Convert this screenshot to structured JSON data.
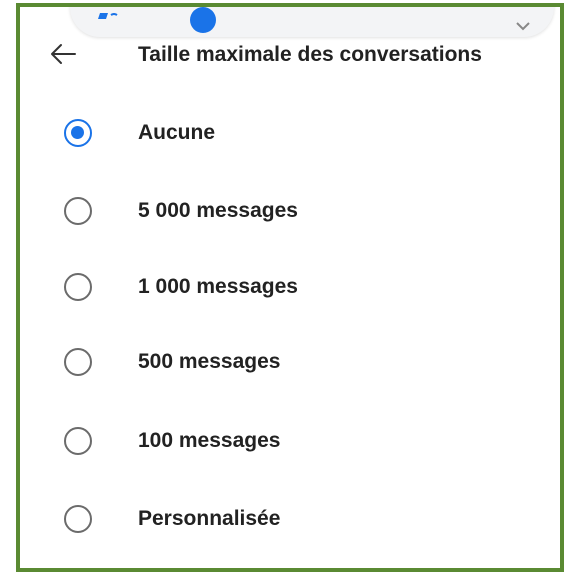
{
  "header": {
    "title": "Taille maximale des conversations",
    "back_icon": "arrow-left-icon"
  },
  "volume_overlay": {
    "speaker_icon": "volume-icon",
    "expand_icon": "chevron-down-icon"
  },
  "options": [
    {
      "label": "Aucune",
      "selected": true
    },
    {
      "label": "5 000 messages",
      "selected": false
    },
    {
      "label": "1 000 messages",
      "selected": false
    },
    {
      "label": "500 messages",
      "selected": false
    },
    {
      "label": "100 messages",
      "selected": false
    },
    {
      "label": "Personnalisée",
      "selected": false
    }
  ],
  "colors": {
    "accent": "#1a73e8",
    "frame_border": "#5a8a32",
    "text": "#222222",
    "radio_unselected": "#6b6b6b"
  }
}
